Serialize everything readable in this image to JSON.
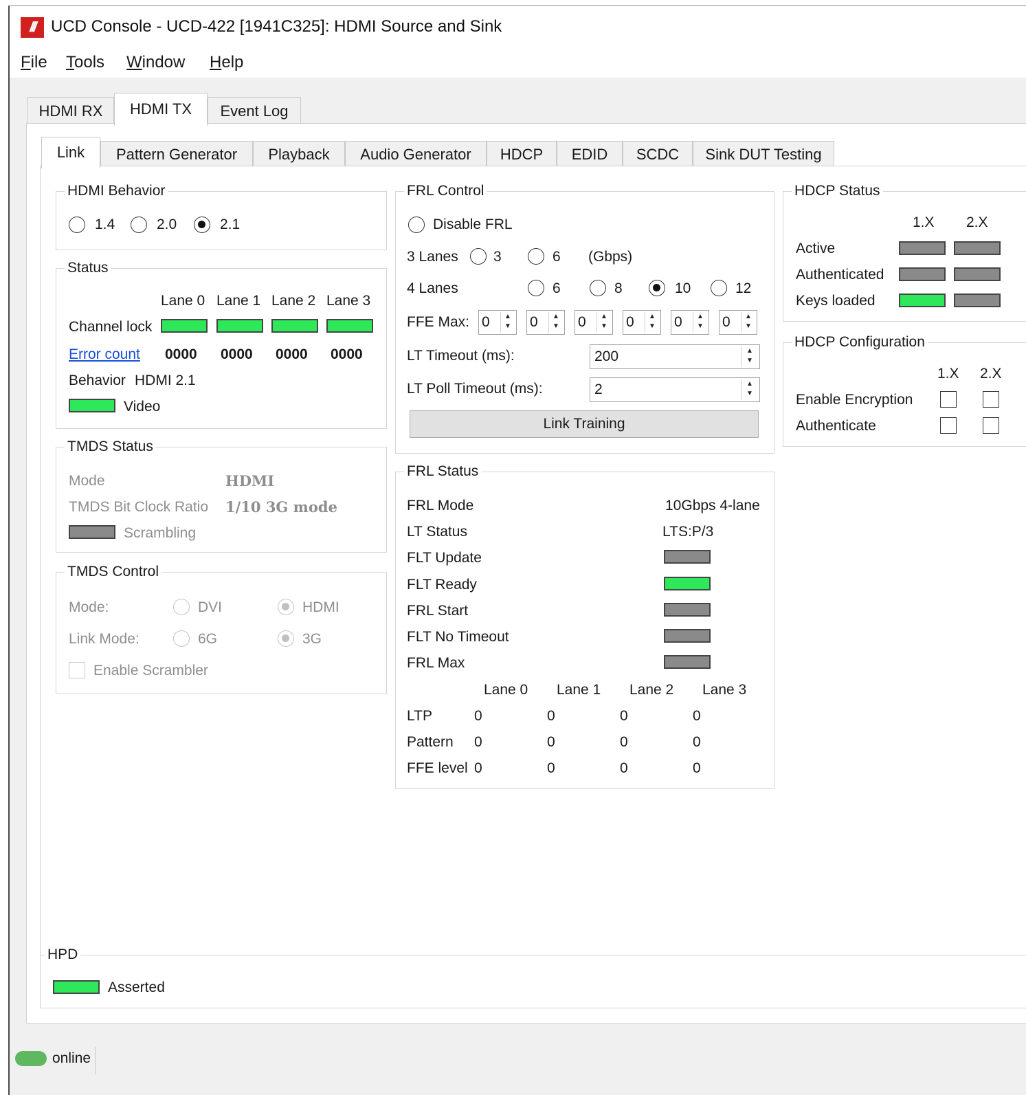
{
  "window": {
    "title": "UCD Console - UCD-422 [1941C325]: HDMI Source and Sink",
    "logo_text": "///"
  },
  "menu": {
    "file": {
      "u": "F",
      "rest": "ile"
    },
    "tools": {
      "u": "T",
      "rest": "ools"
    },
    "window": {
      "u": "W",
      "rest": "indow"
    },
    "help": {
      "u": "H",
      "rest": "elp"
    }
  },
  "main_tabs": [
    "HDMI RX",
    "HDMI TX",
    "Event Log"
  ],
  "sub_tabs": [
    "Link",
    "Pattern Generator",
    "Playback",
    "Audio Generator",
    "HDCP",
    "EDID",
    "SCDC",
    "Sink DUT Testing"
  ],
  "hdmi_behavior": {
    "title": "HDMI Behavior",
    "options": [
      "1.4",
      "2.0",
      "2.1"
    ],
    "selected": "2.1"
  },
  "status": {
    "title": "Status",
    "lanes": [
      "Lane 0",
      "Lane 1",
      "Lane 2",
      "Lane 3"
    ],
    "channel_lock_label": "Channel lock",
    "error_count_label": "Error count",
    "error_counts": [
      "0000",
      "0000",
      "0000",
      "0000"
    ],
    "behavior_label": "Behavior",
    "behavior_value": "HDMI 2.1",
    "video_label": "Video"
  },
  "tmds_status": {
    "title": "TMDS Status",
    "mode_label": "Mode",
    "mode_value": "HDMI",
    "ratio_label": "TMDS Bit Clock Ratio",
    "ratio_value": "1/10 3G mode",
    "scrambling_label": "Scrambling"
  },
  "tmds_control": {
    "title": "TMDS Control",
    "mode_label": "Mode:",
    "mode_options": [
      "DVI",
      "HDMI"
    ],
    "link_mode_label": "Link Mode:",
    "link_mode_options": [
      "6G",
      "3G"
    ],
    "enable_scrambler": "Enable Scrambler"
  },
  "frl_control": {
    "title": "FRL Control",
    "disable_frl": "Disable FRL",
    "lanes3_label": "3 Lanes",
    "lanes3_options": [
      "3",
      "6"
    ],
    "gbps": "(Gbps)",
    "lanes4_label": "4 Lanes",
    "lanes4_options": [
      "6",
      "8",
      "10",
      "12"
    ],
    "selected": "10",
    "ffe_max_label": "FFE Max:",
    "ffe_values": [
      "0",
      "0",
      "0",
      "0",
      "0",
      "0"
    ],
    "lt_timeout_label": "LT Timeout (ms):",
    "lt_timeout_value": "200",
    "lt_poll_label": "LT Poll Timeout (ms):",
    "lt_poll_value": "2",
    "link_training_button": "Link Training"
  },
  "frl_status": {
    "title": "FRL Status",
    "frl_mode_label": "FRL Mode",
    "frl_mode_value": "10Gbps 4-lane",
    "lt_status_label": "LT Status",
    "lt_status_value": "LTS:P/3",
    "indicators": [
      {
        "label": "FLT Update",
        "state": "gray"
      },
      {
        "label": "FLT Ready",
        "state": "green"
      },
      {
        "label": "FRL Start",
        "state": "gray"
      },
      {
        "label": "FLT No Timeout",
        "state": "gray"
      },
      {
        "label": "FRL Max",
        "state": "gray"
      }
    ],
    "lanes": [
      "Lane 0",
      "Lane 1",
      "Lane 2",
      "Lane 3"
    ],
    "rows": [
      {
        "label": "LTP",
        "values": [
          "0",
          "0",
          "0",
          "0"
        ]
      },
      {
        "label": "Pattern",
        "values": [
          "0",
          "0",
          "0",
          "0"
        ]
      },
      {
        "label": "FFE level",
        "values": [
          "0",
          "0",
          "0",
          "0"
        ]
      }
    ]
  },
  "hdcp_status": {
    "title": "HDCP Status",
    "cols": [
      "1.X",
      "2.X"
    ],
    "active": "Active",
    "authenticated": "Authenticated",
    "keys_loaded": "Keys loaded"
  },
  "hdcp_config": {
    "title": "HDCP Configuration",
    "cols": [
      "1.X",
      "2.X"
    ],
    "enable_encryption": "Enable Encryption",
    "authenticate": "Authenticate"
  },
  "hpd": {
    "title": "HPD",
    "asserted": "Asserted"
  },
  "statusbar": {
    "online": "online"
  },
  "colors": {
    "led_green": "#2ee85a",
    "led_gray": "#8a8a8a",
    "link_blue": "#1a4fd8",
    "logo_red": "#d02020"
  }
}
